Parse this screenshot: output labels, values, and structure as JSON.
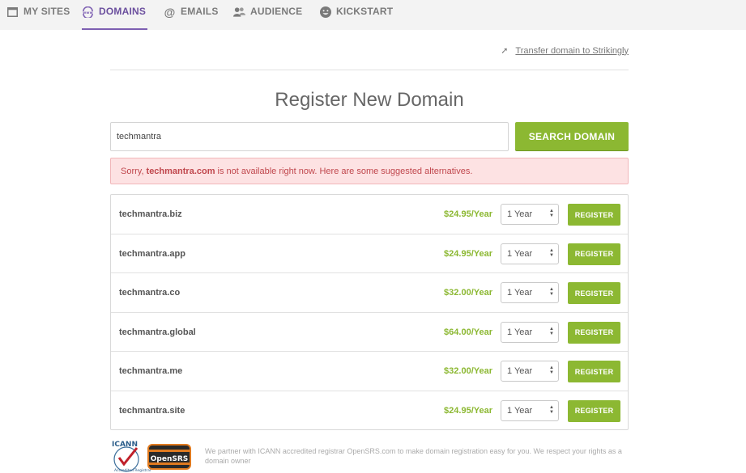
{
  "nav": {
    "items": [
      {
        "label": "MY SITES",
        "icon": "window-icon"
      },
      {
        "label": "DOMAINS",
        "icon": "www-globe-icon",
        "active": true
      },
      {
        "label": "EMAILS",
        "icon": "at-icon"
      },
      {
        "label": "AUDIENCE",
        "icon": "people-icon"
      },
      {
        "label": "KICKSTART",
        "icon": "smiley-icon"
      }
    ]
  },
  "transfer": {
    "label": "Transfer domain to Strikingly"
  },
  "title": "Register New Domain",
  "search": {
    "value": "techmantra",
    "button_label": "SEARCH DOMAIN"
  },
  "alert": {
    "prefix": "Sorry,",
    "domain": "techmantra.com",
    "suffix": "is not available right now. Here are some suggested alternatives."
  },
  "results": [
    {
      "domain": "techmantra.biz",
      "price": "$24.95/Year",
      "period": "1 Year",
      "button": "REGISTER"
    },
    {
      "domain": "techmantra.app",
      "price": "$24.95/Year",
      "period": "1 Year",
      "button": "REGISTER"
    },
    {
      "domain": "techmantra.co",
      "price": "$32.00/Year",
      "period": "1 Year",
      "button": "REGISTER"
    },
    {
      "domain": "techmantra.global",
      "price": "$64.00/Year",
      "period": "1 Year",
      "button": "REGISTER"
    },
    {
      "domain": "techmantra.me",
      "price": "$32.00/Year",
      "period": "1 Year",
      "button": "REGISTER"
    },
    {
      "domain": "techmantra.site",
      "price": "$24.95/Year",
      "period": "1 Year",
      "button": "REGISTER"
    }
  ],
  "footer": {
    "icann_text": "ICANN",
    "icann_sub": "Accredited Registrar",
    "opensrs_text": "OpenSRS",
    "text": "We partner with ICANN accredited registrar OpenSRS.com to make domain registration easy for you. We respect your rights as a domain owner"
  },
  "colors": {
    "accent_green": "#8cb832",
    "accent_purple": "#6b4f9e",
    "alert_bg": "#fde2e3",
    "alert_text": "#c0474d"
  }
}
